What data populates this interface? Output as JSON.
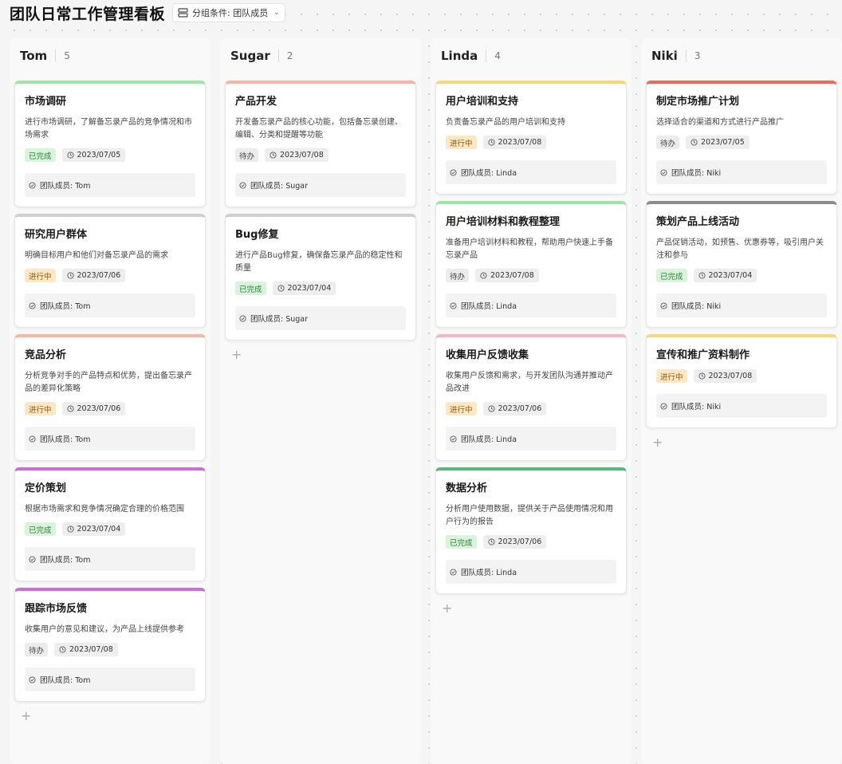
{
  "header": {
    "title": "团队日常工作管理看板",
    "group_label": "分组条件: 团队成员"
  },
  "icons": {
    "group": "group-by-icon",
    "dropdown": "chevron-down-icon",
    "date": "clock-icon",
    "member": "check-circle-icon",
    "add": "plus-icon"
  },
  "status_styles": {
    "已完成": {
      "bg": "#d8f5dc",
      "fg": "#2f7d3c"
    },
    "进行中": {
      "bg": "#fde8c3",
      "fg": "#8a5a12"
    },
    "待办": {
      "bg": "#ececec",
      "fg": "#444444"
    }
  },
  "add_label": "+",
  "columns": [
    {
      "name": "Tom",
      "count": "5",
      "cards": [
        {
          "title": "市场调研",
          "desc": "进行市场调研，了解备忘录产品的竞争情况和市场需求",
          "status": "已完成",
          "date": "2023/07/05",
          "member": "团队成员: Tom",
          "color": "#9ee6a4"
        },
        {
          "title": "研究用户群体",
          "desc": "明确目标用户和他们对备忘录产品的需求",
          "status": "进行中",
          "date": "2023/07/06",
          "member": "团队成员: Tom",
          "color": "#cfcfcf"
        },
        {
          "title": "竞品分析",
          "desc": "分析竞争对手的产品特点和优势，提出备忘录产品的差异化策略",
          "status": "进行中",
          "date": "2023/07/06",
          "member": "团队成员: Tom",
          "color": "#f6b69f"
        },
        {
          "title": "定价策划",
          "desc": "根据市场需求和竞争情况确定合理的价格范围",
          "status": "已完成",
          "date": "2023/07/04",
          "member": "团队成员: Tom",
          "color": "#c96fd6"
        },
        {
          "title": "跟踪市场反馈",
          "desc": "收集用户的意见和建议，为产品上线提供参考",
          "status": "待办",
          "date": "2023/07/08",
          "member": "团队成员: Tom",
          "color": "#c96fd6"
        }
      ]
    },
    {
      "name": "Sugar",
      "count": "2",
      "cards": [
        {
          "title": "产品开发",
          "desc": "开发备忘录产品的核心功能，包括备忘录创建、编辑、分类和提醒等功能",
          "status": "待办",
          "date": "2023/07/08",
          "member": "团队成员: Sugar",
          "color": "#f6b69f"
        },
        {
          "title": "Bug修复",
          "desc": "进行产品Bug修复，确保备忘录产品的稳定性和质量",
          "status": "已完成",
          "date": "2023/07/04",
          "member": "团队成员: Sugar",
          "color": "#cfcfcf"
        }
      ]
    },
    {
      "name": "Linda",
      "count": "4",
      "cards": [
        {
          "title": "用户培训和支持",
          "desc": "负责备忘录产品的用户培训和支持",
          "status": "进行中",
          "date": "2023/07/08",
          "member": "团队成员: Linda",
          "color": "#f8d77a"
        },
        {
          "title": "用户培训材料和教程整理",
          "desc": "准备用户培训材料和教程，帮助用户快速上手备忘录产品",
          "status": "待办",
          "date": "2023/07/08",
          "member": "团队成员: Linda",
          "color": "#9ee6a4"
        },
        {
          "title": "收集用户反馈收集",
          "desc": "收集用户反馈和需求，与开发团队沟通并推动产品改进",
          "status": "进行中",
          "date": "2023/07/06",
          "member": "团队成员: Linda",
          "color": "#f7b6c6"
        },
        {
          "title": "数据分析",
          "desc": "分析用户使用数据，提供关于产品使用情况和用户行为的报告",
          "status": "已完成",
          "date": "2023/07/06",
          "member": "团队成员: Linda",
          "color": "#5cb87a"
        }
      ]
    },
    {
      "name": "Niki",
      "count": "3",
      "cards": [
        {
          "title": "制定市场推广计划",
          "desc": "选择适合的渠道和方式进行产品推广",
          "status": "待办",
          "date": "2023/07/05",
          "member": "团队成员: Niki",
          "color": "#ef6b5c"
        },
        {
          "title": "策划产品上线活动",
          "desc": "产品促销活动，如预售、优惠券等，吸引用户关注和参与",
          "status": "已完成",
          "date": "2023/07/04",
          "member": "团队成员: Niki",
          "color": "#8c8c8c"
        },
        {
          "title": "宣传和推广资料制作",
          "desc": "",
          "status": "进行中",
          "date": "2023/07/08",
          "member": "团队成员: Niki",
          "color": "#f8d77a"
        }
      ]
    }
  ]
}
